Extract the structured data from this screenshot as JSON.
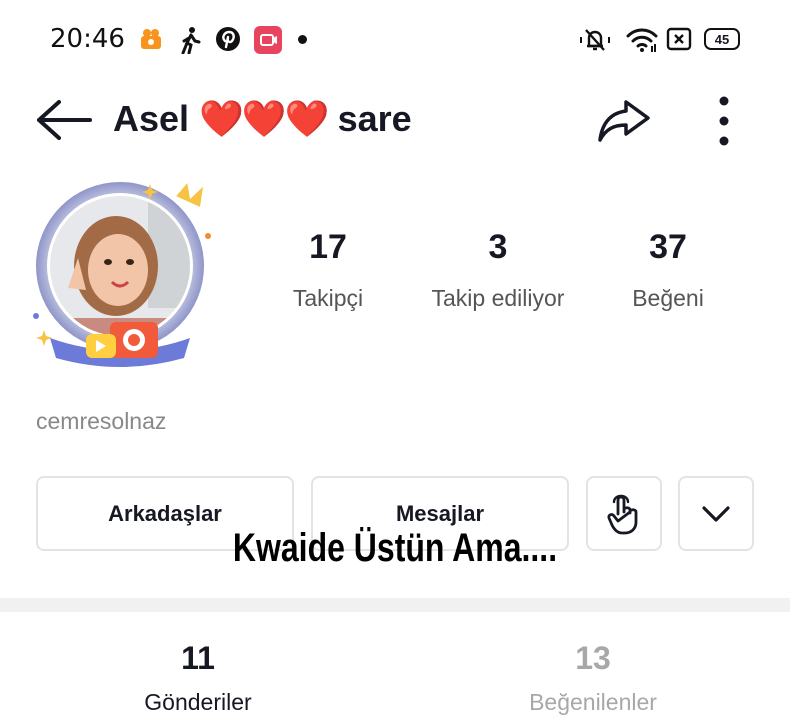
{
  "status_bar": {
    "time": "20:46",
    "battery": "45",
    "icons": [
      "kwai-app-icon",
      "walking-icon",
      "pinterest-icon",
      "screen-record-icon",
      "notification-dot",
      "silent-icon",
      "wifi-icon",
      "sim-icon",
      "battery-icon"
    ]
  },
  "header": {
    "title_part1": "Asel",
    "title_emoji": "❤️❤️❤️",
    "title_part2": "sare",
    "icons": [
      "back-arrow-icon",
      "share-icon",
      "more-vertical-icon"
    ]
  },
  "profile": {
    "username": "cemresolnaz",
    "stats": [
      {
        "value": "17",
        "label": "Takipçi"
      },
      {
        "value": "3",
        "label": "Takip ediliyor"
      },
      {
        "value": "37",
        "label": "Beğeni"
      }
    ]
  },
  "actions": {
    "friends_label": "Arkadaşlar",
    "messages_label": "Mesajlar",
    "icons": [
      "tap-hand-icon",
      "chevron-down-icon"
    ]
  },
  "overlay_caption": "Kwaide Üstün Ama....",
  "tabs": [
    {
      "value": "11",
      "label": "Gönderiler",
      "active": true
    },
    {
      "value": "13",
      "label": "Beğenilenler",
      "active": false
    }
  ],
  "colors": {
    "text_primary": "#161823",
    "text_secondary": "#888888",
    "border": "#e3e3e4",
    "divider": "#f1f1f2",
    "heart": "#e8212b",
    "tab_inactive": "#a8a8ab"
  }
}
